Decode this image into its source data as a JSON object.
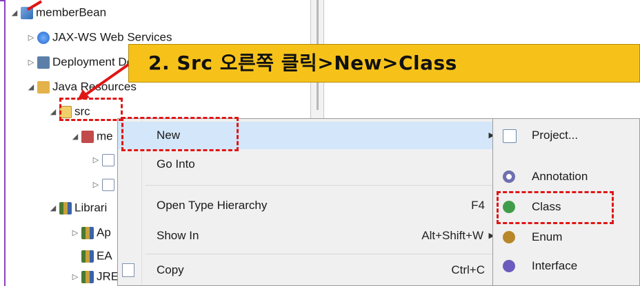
{
  "tree": {
    "items": [
      {
        "label": "memberBean",
        "twisty": "◢",
        "icon": "project-icon"
      },
      {
        "label": "JAX-WS Web Services",
        "twisty": "▷",
        "icon": "web-services-icon"
      },
      {
        "label": "Deployment Descriptor",
        "twisty": "▷",
        "icon": "deployment-icon"
      },
      {
        "label": "Java Resources",
        "twisty": "◢",
        "icon": "java-resources-icon"
      },
      {
        "label": "src",
        "twisty": "◢",
        "icon": "source-folder-icon"
      },
      {
        "label": "me",
        "twisty": "◢",
        "icon": "package-icon"
      },
      {
        "label": "",
        "twisty": "▷",
        "icon": "java-file-icon"
      },
      {
        "label": "",
        "twisty": "▷",
        "icon": "java-file-icon"
      },
      {
        "label": "Librari",
        "twisty": "◢",
        "icon": "libraries-icon"
      },
      {
        "label": "Ap",
        "twisty": "▷",
        "icon": "library-icon"
      },
      {
        "label": "EA",
        "twisty": "",
        "icon": "library-icon"
      },
      {
        "label": "JRE",
        "twisty": "▷",
        "icon": "library-icon"
      }
    ]
  },
  "context_menu": {
    "items": [
      {
        "label": "New",
        "shortcut": "",
        "submenu": true
      },
      {
        "label": "Go Into",
        "shortcut": "",
        "submenu": false
      },
      {
        "label": "Open Type Hierarchy",
        "shortcut": "F4",
        "submenu": false
      },
      {
        "label": "Show In",
        "shortcut": "Alt+Shift+W",
        "submenu": true
      },
      {
        "label": "Copy",
        "shortcut": "Ctrl+C",
        "submenu": false
      }
    ],
    "submenu_arrow": "▶"
  },
  "new_submenu": {
    "items": [
      {
        "label": "Project...",
        "icon": "project-wizard-icon"
      },
      {
        "label": "Annotation",
        "icon": "annotation-icon"
      },
      {
        "label": "Class",
        "icon": "class-icon"
      },
      {
        "label": "Enum",
        "icon": "enum-icon"
      },
      {
        "label": "Interface",
        "icon": "interface-icon"
      }
    ]
  },
  "callout": {
    "text": "2.  Src 오른쪽 클릭>New>Class"
  },
  "colors": {
    "callout_bg": "#f6c21a",
    "highlight_red": "#e01515",
    "menu_bg": "#f0f0f0",
    "window_border": "#8a3fbf"
  }
}
